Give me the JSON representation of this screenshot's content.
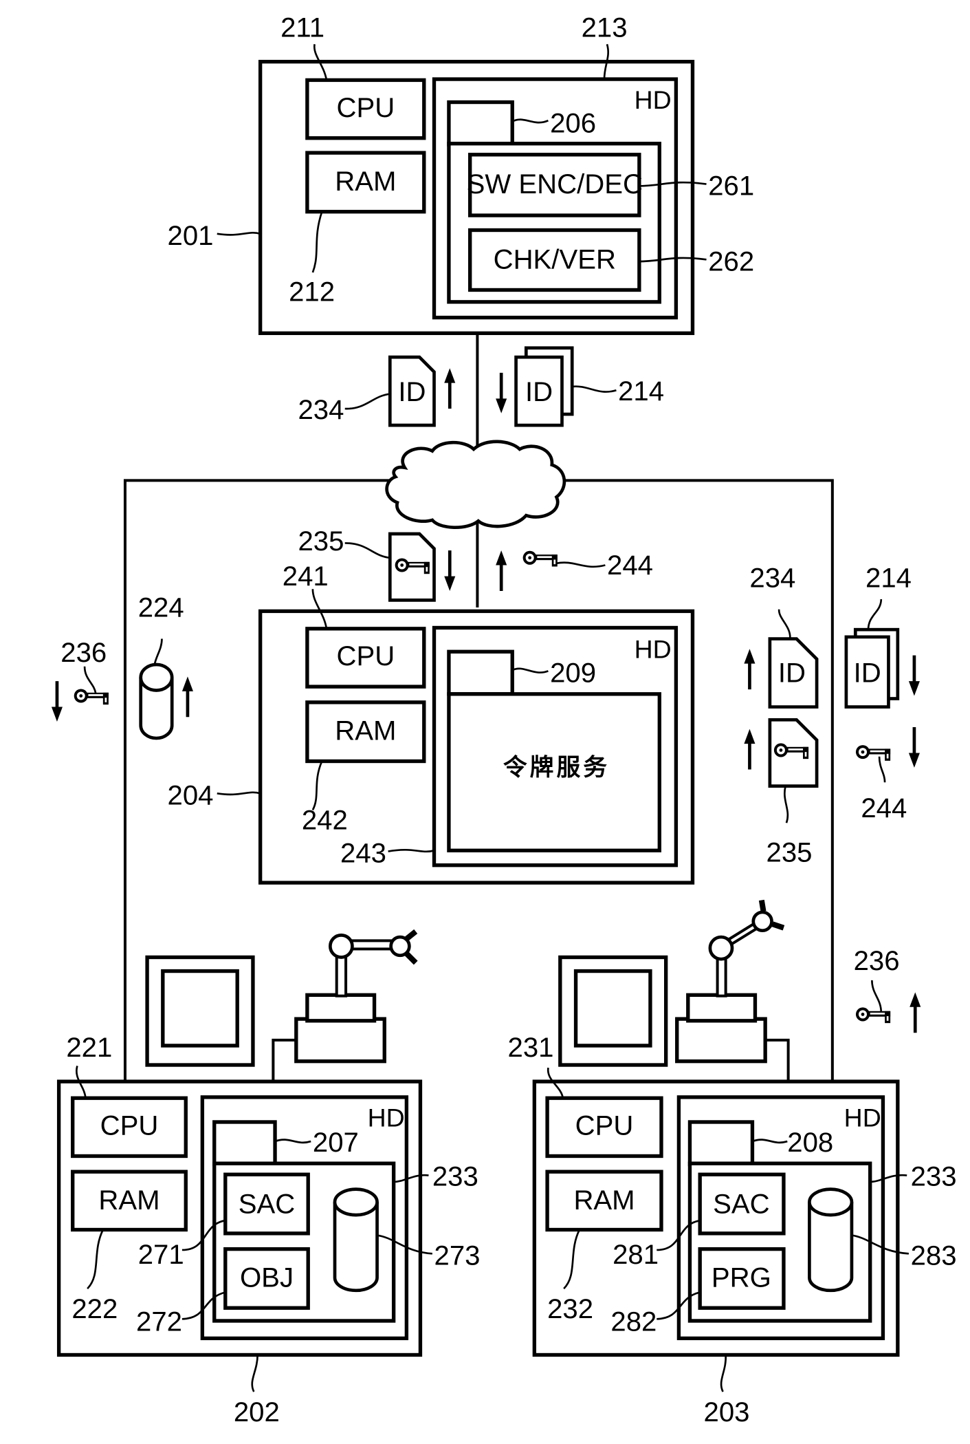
{
  "figure": {
    "server": {
      "ref": "201",
      "cpu": {
        "label": "CPU",
        "ref": "211"
      },
      "ram": {
        "label": "RAM",
        "ref": "212"
      },
      "hd": {
        "label": "HD",
        "ref": "213"
      },
      "module": {
        "ref": "206"
      },
      "enc": {
        "label": "SW ENC/DEC",
        "ref": "261"
      },
      "chk": {
        "label": "CHK/VER",
        "ref": "262"
      }
    },
    "uplink": {
      "id_up": {
        "label": "ID",
        "ref": "234"
      },
      "id_down": {
        "label": "ID",
        "ref": "214"
      }
    },
    "network": {
      "key_doc": {
        "ref": "235"
      },
      "key": {
        "ref": "244"
      }
    },
    "token_server": {
      "ref": "204",
      "cpu": {
        "label": "CPU",
        "ref": "241"
      },
      "ram": {
        "label": "RAM",
        "ref": "242"
      },
      "hd": {
        "label": "HD",
        "ref": "243"
      },
      "module": {
        "ref": "209"
      },
      "service": {
        "label": "令牌服务"
      }
    },
    "left_side": {
      "key": {
        "ref": "236"
      },
      "db": {
        "ref": "224"
      }
    },
    "right_side": {
      "id_doc": {
        "label": "ID",
        "ref": "234"
      },
      "id_stack": {
        "label": "ID",
        "ref": "214"
      },
      "key_doc": {
        "ref": "235"
      },
      "key": {
        "ref": "244"
      },
      "key_lower": {
        "ref": "236"
      }
    },
    "device_left": {
      "ref": "202",
      "cpu": {
        "label": "CPU",
        "ref": "221"
      },
      "ram": {
        "label": "RAM",
        "ref": "222"
      },
      "hd": {
        "label": "HD",
        "ref": "233"
      },
      "module": {
        "ref": "207"
      },
      "sac": {
        "label": "SAC",
        "ref": "271"
      },
      "obj": {
        "label": "OBJ",
        "ref": "272"
      },
      "db": {
        "ref": "273"
      }
    },
    "device_right": {
      "ref": "203",
      "cpu": {
        "label": "CPU",
        "ref": "231"
      },
      "ram": {
        "label": "RAM",
        "ref": "232"
      },
      "hd": {
        "label": "HD",
        "ref": "233"
      },
      "module": {
        "ref": "208"
      },
      "sac": {
        "label": "SAC",
        "ref": "281"
      },
      "prg": {
        "label": "PRG",
        "ref": "282"
      },
      "db": {
        "ref": "283"
      }
    },
    "icons": {
      "document": "id-document-icon",
      "document_stack": "id-document-stack-icon",
      "key": "key-icon",
      "key_document": "key-document-icon",
      "database": "database-cylinder-icon",
      "monitor": "monitor-icon",
      "robot_arm": "robot-arm-icon",
      "cloud": "network-cloud-icon",
      "arrow_up": "arrow-up-icon",
      "arrow_down": "arrow-down-icon"
    }
  }
}
